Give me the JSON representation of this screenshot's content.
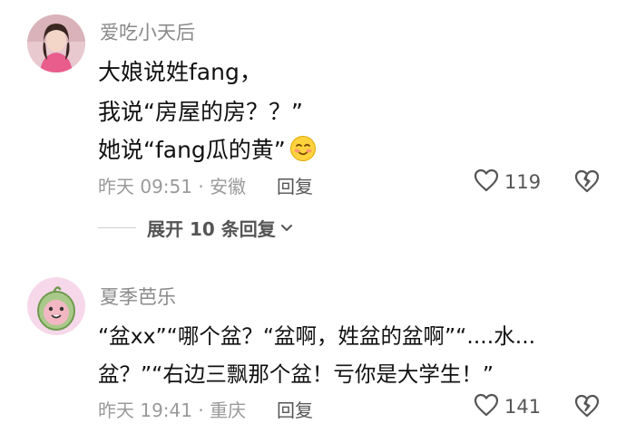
{
  "comments": [
    {
      "username": "爱吃小天后",
      "lines": [
        "大娘说姓fang，",
        "我说“房屋的房？？”",
        "她说“fang瓜的黄”"
      ],
      "emoji_icon": "blushing-smile-emoji",
      "meta": "昨天 09:51 · 安徽",
      "reply_label": "回复",
      "likes": "119",
      "expand_label": "展开 10 条回复"
    },
    {
      "username": "夏季芭乐",
      "lines": [
        "“盆xx”“哪个盆？“盆啊，姓盆的盆啊”“....水...",
        "盆？”“右边三飘那个盆！亏你是大学生！”"
      ],
      "meta": "昨天 19:41 · 重庆",
      "reply_label": "回复",
      "likes": "141"
    }
  ],
  "colors": {
    "username": "#8a8a8a",
    "meta": "#9a9a9a",
    "icon": "#555555",
    "guava_avatar_bg": "#f6d8ea"
  }
}
